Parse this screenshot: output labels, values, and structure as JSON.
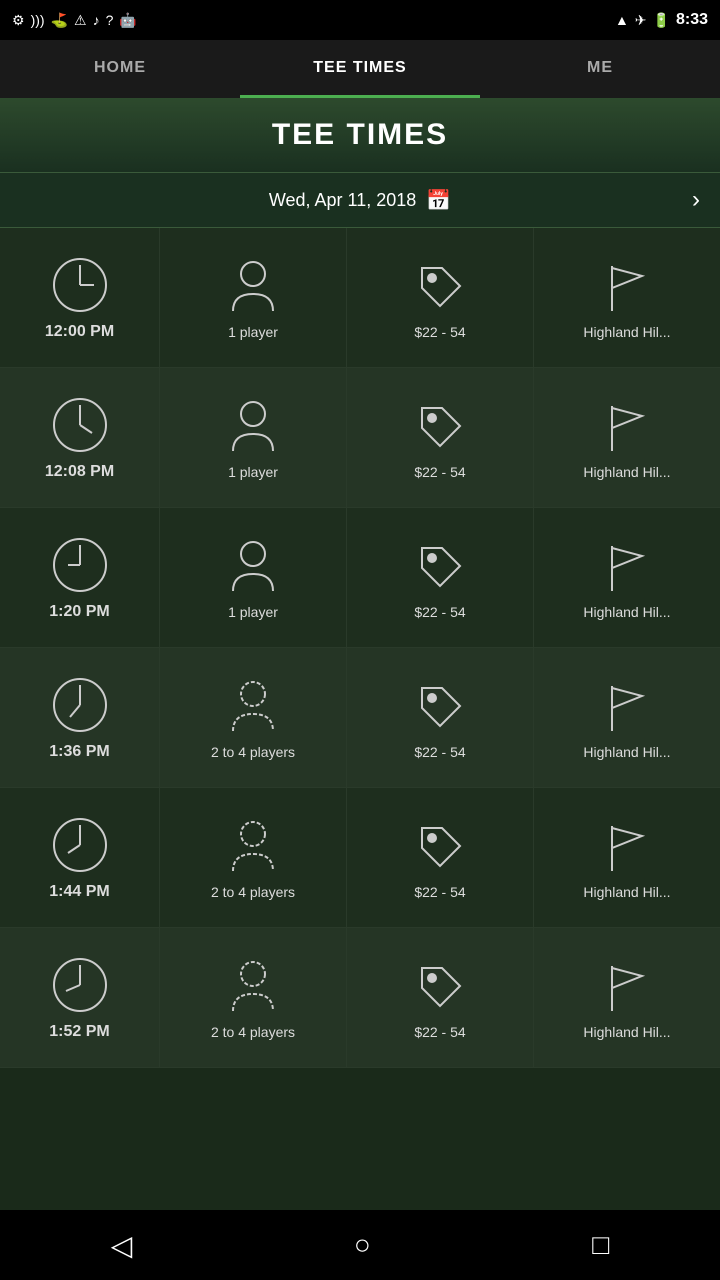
{
  "statusBar": {
    "time": "8:33",
    "icons": [
      "settings",
      "wifi",
      "golf",
      "alert",
      "music",
      "help",
      "android",
      "wifi-signal",
      "airplane",
      "battery"
    ]
  },
  "nav": {
    "tabs": [
      {
        "id": "home",
        "label": "HOME",
        "active": false
      },
      {
        "id": "tee-times",
        "label": "TEE TIMES",
        "active": true
      },
      {
        "id": "me",
        "label": "ME",
        "active": false
      }
    ]
  },
  "pageTitle": "TEE TIMES",
  "dateSelector": {
    "date": "Wed, Apr 11, 2018",
    "calendarIcon": "calendar-icon",
    "nextIcon": "chevron-right-icon"
  },
  "teeRows": [
    {
      "time": "12:00 PM",
      "players": "1 player",
      "price": "$22 - 54",
      "course": "Highland Hil..."
    },
    {
      "time": "12:08 PM",
      "players": "1 player",
      "price": "$22 - 54",
      "course": "Highland Hil..."
    },
    {
      "time": "1:20 PM",
      "players": "1 player",
      "price": "$22 - 54",
      "course": "Highland Hil..."
    },
    {
      "time": "1:36 PM",
      "players": "2 to 4 players",
      "price": "$22 - 54",
      "course": "Highland Hil..."
    },
    {
      "time": "1:44 PM",
      "players": "2 to 4 players",
      "price": "$22 - 54",
      "course": "Highland Hil..."
    },
    {
      "time": "1:52 PM",
      "players": "2 to 4 players",
      "price": "$22 - 54",
      "course": "Highland Hil..."
    }
  ],
  "bottomNav": {
    "back": "◁",
    "home": "○",
    "recent": "□"
  }
}
